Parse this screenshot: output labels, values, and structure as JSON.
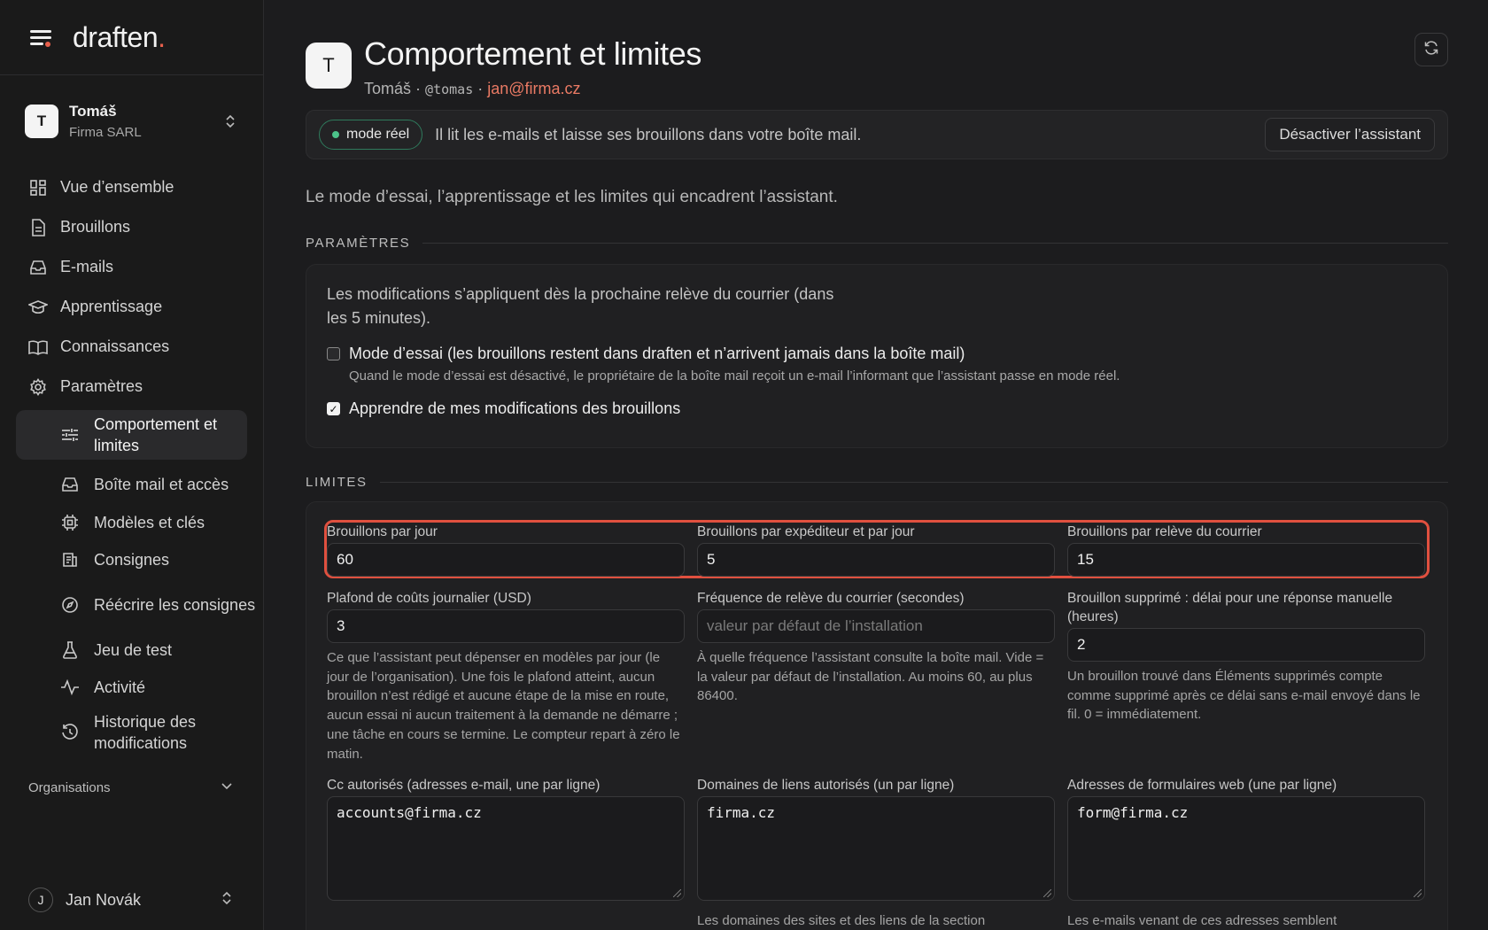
{
  "app": {
    "logo_text": "draften",
    "logo_dot": ".",
    "accent": "#e8604c"
  },
  "tenant": {
    "initial": "T",
    "name": "Tomáš",
    "org": "Firma SARL"
  },
  "nav": [
    {
      "label": "Vue d’ensemble",
      "icon": "dashboard-icon"
    },
    {
      "label": "Brouillons",
      "icon": "document-icon"
    },
    {
      "label": "E-mails",
      "icon": "inbox-icon"
    },
    {
      "label": "Apprentissage",
      "icon": "graduation-cap-icon"
    },
    {
      "label": "Connaissances",
      "icon": "book-icon"
    },
    {
      "label": "Paramètres",
      "icon": "gear-icon"
    }
  ],
  "subnav": [
    {
      "label": "Comportement et limites",
      "icon": "sliders-icon",
      "active": true
    },
    {
      "label": "Boîte mail et accès",
      "icon": "inbox-icon"
    },
    {
      "label": "Modèles et clés",
      "icon": "chip-icon"
    },
    {
      "label": "Consignes",
      "icon": "list-icon"
    },
    {
      "label": "Réécrire les consignes",
      "icon": "compass-icon"
    },
    {
      "label": "Jeu de test",
      "icon": "flask-icon"
    },
    {
      "label": "Activité",
      "icon": "activity-icon"
    },
    {
      "label": "Historique des modifications",
      "icon": "history-icon"
    }
  ],
  "organisations_label": "Organisations",
  "user": {
    "initial": "J",
    "name": "Jan Novák"
  },
  "header": {
    "initial": "T",
    "title": "Comportement et limites",
    "name": "Tomáš",
    "sep": "·",
    "handle": "@tomas",
    "email": "jan@firma.cz"
  },
  "status": {
    "badge": "mode réel",
    "text": "Il lit les e-mails et laisse ses brouillons dans votre boîte mail.",
    "button": "Désactiver l’assistant"
  },
  "intro": "Le mode d’essai, l’apprentissage et les limites qui encadrent l’assistant.",
  "settings": {
    "heading": "PARAMÈTRES",
    "note": "Les modifications s’appliquent dès la prochaine relève du courrier (dans les 5 minutes).",
    "trial": {
      "label": "Mode d’essai (les brouillons restent dans draften et n’arrivent jamais dans la boîte mail)",
      "hint": "Quand le mode d’essai est désactivé, le propriétaire de la boîte mail reçoit un e-mail l’informant que l’assistant passe en mode réel.",
      "checked": false
    },
    "learn": {
      "label": "Apprendre de mes modifications des brouillons",
      "checked": true
    }
  },
  "limits": {
    "heading": "LIMITES",
    "fields": {
      "per_day": {
        "label": "Brouillons par jour",
        "value": "60"
      },
      "per_sender": {
        "label": "Brouillons par expéditeur et par jour",
        "value": "5"
      },
      "per_fetch": {
        "label": "Brouillons par relève du courrier",
        "value": "15"
      },
      "cost_cap": {
        "label": "Plafond de coûts journalier (USD)",
        "value": "3",
        "help": "Ce que l’assistant peut dépenser en modèles par jour (le jour de l’organisation). Une fois le plafond atteint, aucun brouillon n’est rédigé et aucune étape de la mise en route, aucun essai ni aucun traitement à la demande ne démarre ; une tâche en cours se termine. Le compteur repart à zéro le matin."
      },
      "fetch_freq": {
        "label": "Fréquence de relève du courrier (secondes)",
        "placeholder": "valeur par défaut de l’installation",
        "help": "À quelle fréquence l’assistant consulte la boîte mail. Vide = la valeur par défaut de l’installation. Au moins 60, au plus 86400."
      },
      "deleted_delay": {
        "label": "Brouillon supprimé : délai pour une réponse manuelle (heures)",
        "value": "2",
        "help": "Un brouillon trouvé dans Éléments supprimés compte comme supprimé après ce délai sans e-mail envoyé dans le fil. 0 = immédiatement."
      },
      "cc_allowed": {
        "label": "Cc autorisés (adresses e-mail, une par ligne)",
        "value": "accounts@firma.cz"
      },
      "link_domains": {
        "label": "Domaines de liens autorisés (un par ligne)",
        "value": "firma.cz",
        "help": "Les domaines des sites et des liens de la section"
      },
      "web_forms": {
        "label": "Adresses de formulaires web (une par ligne)",
        "value": "form@firma.cz",
        "help": "Les e-mails venant de ces adresses semblent"
      }
    }
  }
}
